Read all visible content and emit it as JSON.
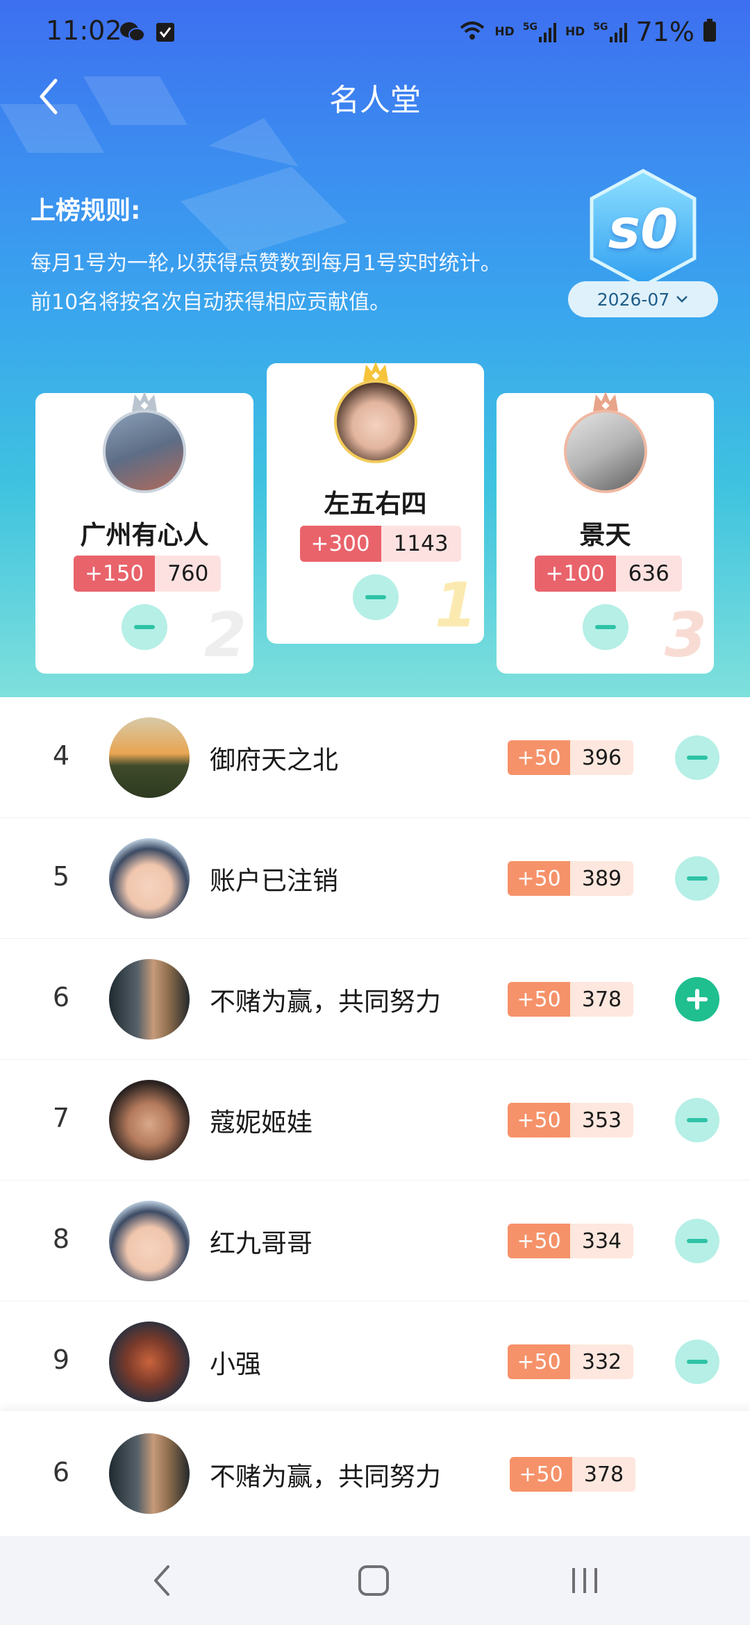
{
  "status_bar": {
    "time": "11:02",
    "hd1": "HD",
    "net1": "5G",
    "hd2": "HD",
    "net2": "5G",
    "battery": "71%"
  },
  "header": {
    "title": "名人堂"
  },
  "rules": {
    "title": "上榜规则:",
    "line1": "每月1号为一轮,以获得点赞数到每月1号实时统计。",
    "line2": "前10名将按名次自动获得相应贡献值。"
  },
  "season": {
    "label": "s0",
    "month": "2026-07"
  },
  "podium": {
    "first": {
      "name": "左五右四",
      "bonus": "+300",
      "total": "1143",
      "rank": "1"
    },
    "second": {
      "name": "广州有心人",
      "bonus": "+150",
      "total": "760",
      "rank": "2"
    },
    "third": {
      "name": "景天",
      "bonus": "+100",
      "total": "636",
      "rank": "3"
    }
  },
  "list": [
    {
      "rank": "4",
      "name": "御府天之北",
      "bonus": "+50",
      "total": "396",
      "action": "minus"
    },
    {
      "rank": "5",
      "name": "账户已注销",
      "bonus": "+50",
      "total": "389",
      "action": "minus"
    },
    {
      "rank": "6",
      "name": "不赌为赢，共同努力",
      "bonus": "+50",
      "total": "378",
      "action": "plus"
    },
    {
      "rank": "7",
      "name": "蔻妮姬娃",
      "bonus": "+50",
      "total": "353",
      "action": "minus"
    },
    {
      "rank": "8",
      "name": "红九哥哥",
      "bonus": "+50",
      "total": "334",
      "action": "minus"
    },
    {
      "rank": "9",
      "name": "小强",
      "bonus": "+50",
      "total": "332",
      "action": "minus"
    }
  ],
  "my_rank": {
    "rank": "6",
    "name": "不赌为赢，共同努力",
    "bonus": "+50",
    "total": "378"
  },
  "colors": {
    "hero_top": "#3d6ff0",
    "hero_bottom": "#7fe0dc",
    "podium_bonus": "#e9636b",
    "list_bonus": "#f6926a",
    "action_teal": "#2fc3a6",
    "action_plus": "#1fbf8f"
  },
  "icons": {
    "back": "back-arrow-icon",
    "chevron": "chevron-down-icon",
    "minus": "minus-icon",
    "plus": "plus-icon",
    "crown": "crown-icon"
  }
}
